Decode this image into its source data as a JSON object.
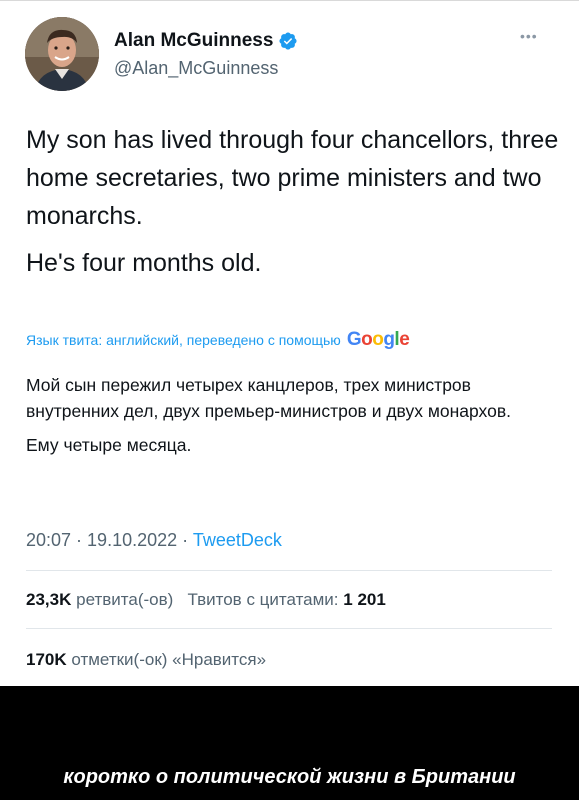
{
  "tweet": {
    "display_name": "Alan McGuinness",
    "handle": "@Alan_McGuinness",
    "verified": true,
    "text_paragraphs": [
      "My son has lived through four chancellors, three home secretaries, two prime ministers and two monarchs.",
      "He's four months old."
    ],
    "translate_note": "Язык твита: английский, переведено с помощью",
    "translator": "Google",
    "translated_paragraphs": [
      "Мой сын пережил четырех канцлеров, трех министров внутренних дел, двух премьер-министров и двух монархов.",
      "Ему четыре месяца."
    ],
    "time": "20:07",
    "date": "19.10.2022",
    "source": "TweetDeck",
    "separator": " · "
  },
  "stats": {
    "retweets_count": "23,3K",
    "retweets_label": "ретвита(-ов)",
    "quotes_label": "Твитов с цитатами:",
    "quotes_count": "1 201",
    "likes_count": "170K",
    "likes_label": "отметки(-ок) «Нравится»"
  },
  "caption": "коротко о политической жизни в Британии",
  "colors": {
    "accent": "#1d9bf0",
    "text": "#0f1419",
    "muted": "#536471",
    "caption_bg": "#000000"
  },
  "icons": [
    "avatar-photo",
    "verified-badge-icon",
    "more-options-icon"
  ]
}
